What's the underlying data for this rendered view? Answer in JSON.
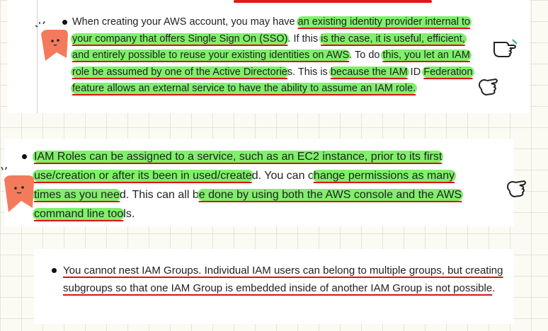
{
  "note1": {
    "segments": [
      {
        "text": "When creating your AWS account, you may have ",
        "hl": false,
        "ul": false
      },
      {
        "text": "an existing identity provider internal to your company that offers Single Sign On (SSO)",
        "hl": true,
        "ul": true
      },
      {
        "text": ". If this ",
        "hl": false,
        "ul": false
      },
      {
        "text": "is the case, it is useful, efficient, and entirely possible to reuse your existing identities on AWS",
        "hl": true,
        "ul": true
      },
      {
        "text": ". To do ",
        "hl": false,
        "ul": false
      },
      {
        "text": "this, you let an IAM role be assumed by one of the Active Directorie",
        "hl": true,
        "ul": true
      },
      {
        "text": "s. This is ",
        "hl": false,
        "ul": false
      },
      {
        "text": "because the IAM",
        "hl": true,
        "ul": true
      },
      {
        "text": " ID ",
        "hl": false,
        "ul": false
      },
      {
        "text": "Federation feature allows an external service to have the ability to assume an IAM role.",
        "hl": true,
        "ul": true
      }
    ]
  },
  "note2": {
    "segments": [
      {
        "text": "IAM Roles can be assigned to a service, such as an EC2 instance, prior to its first use/creation or after its been in used/create",
        "hl": true,
        "ul": true
      },
      {
        "text": "d. You can c",
        "hl": false,
        "ul": false
      },
      {
        "text": "hange permissions as many times as you nee",
        "hl": true,
        "ul": true
      },
      {
        "text": "d. This can all b",
        "hl": false,
        "ul": false
      },
      {
        "text": "e done by using both the AWS console and the AWS command line too",
        "hl": true,
        "ul": true
      },
      {
        "text": "ls.",
        "hl": false,
        "ul": false
      }
    ]
  },
  "note3": {
    "segments": [
      {
        "text": "You cannot nest IAM Groups. Individual IAM users can belong to multiple groups, but creating subgroups so that one IAM Group is embedded inside of another IAM Group is not possible",
        "hl": false,
        "ul": true
      },
      {
        "text": ".",
        "hl": false,
        "ul": false
      }
    ]
  },
  "icons": {
    "mascot": "orange-bookmark-mascot-icon",
    "pointing_hand": "pointing-hand-icon",
    "ok_hand": "ok-hand-icon"
  },
  "colors": {
    "highlight": "#7ff06a",
    "underline": "#e01010",
    "mascot": "#f47a5c"
  }
}
